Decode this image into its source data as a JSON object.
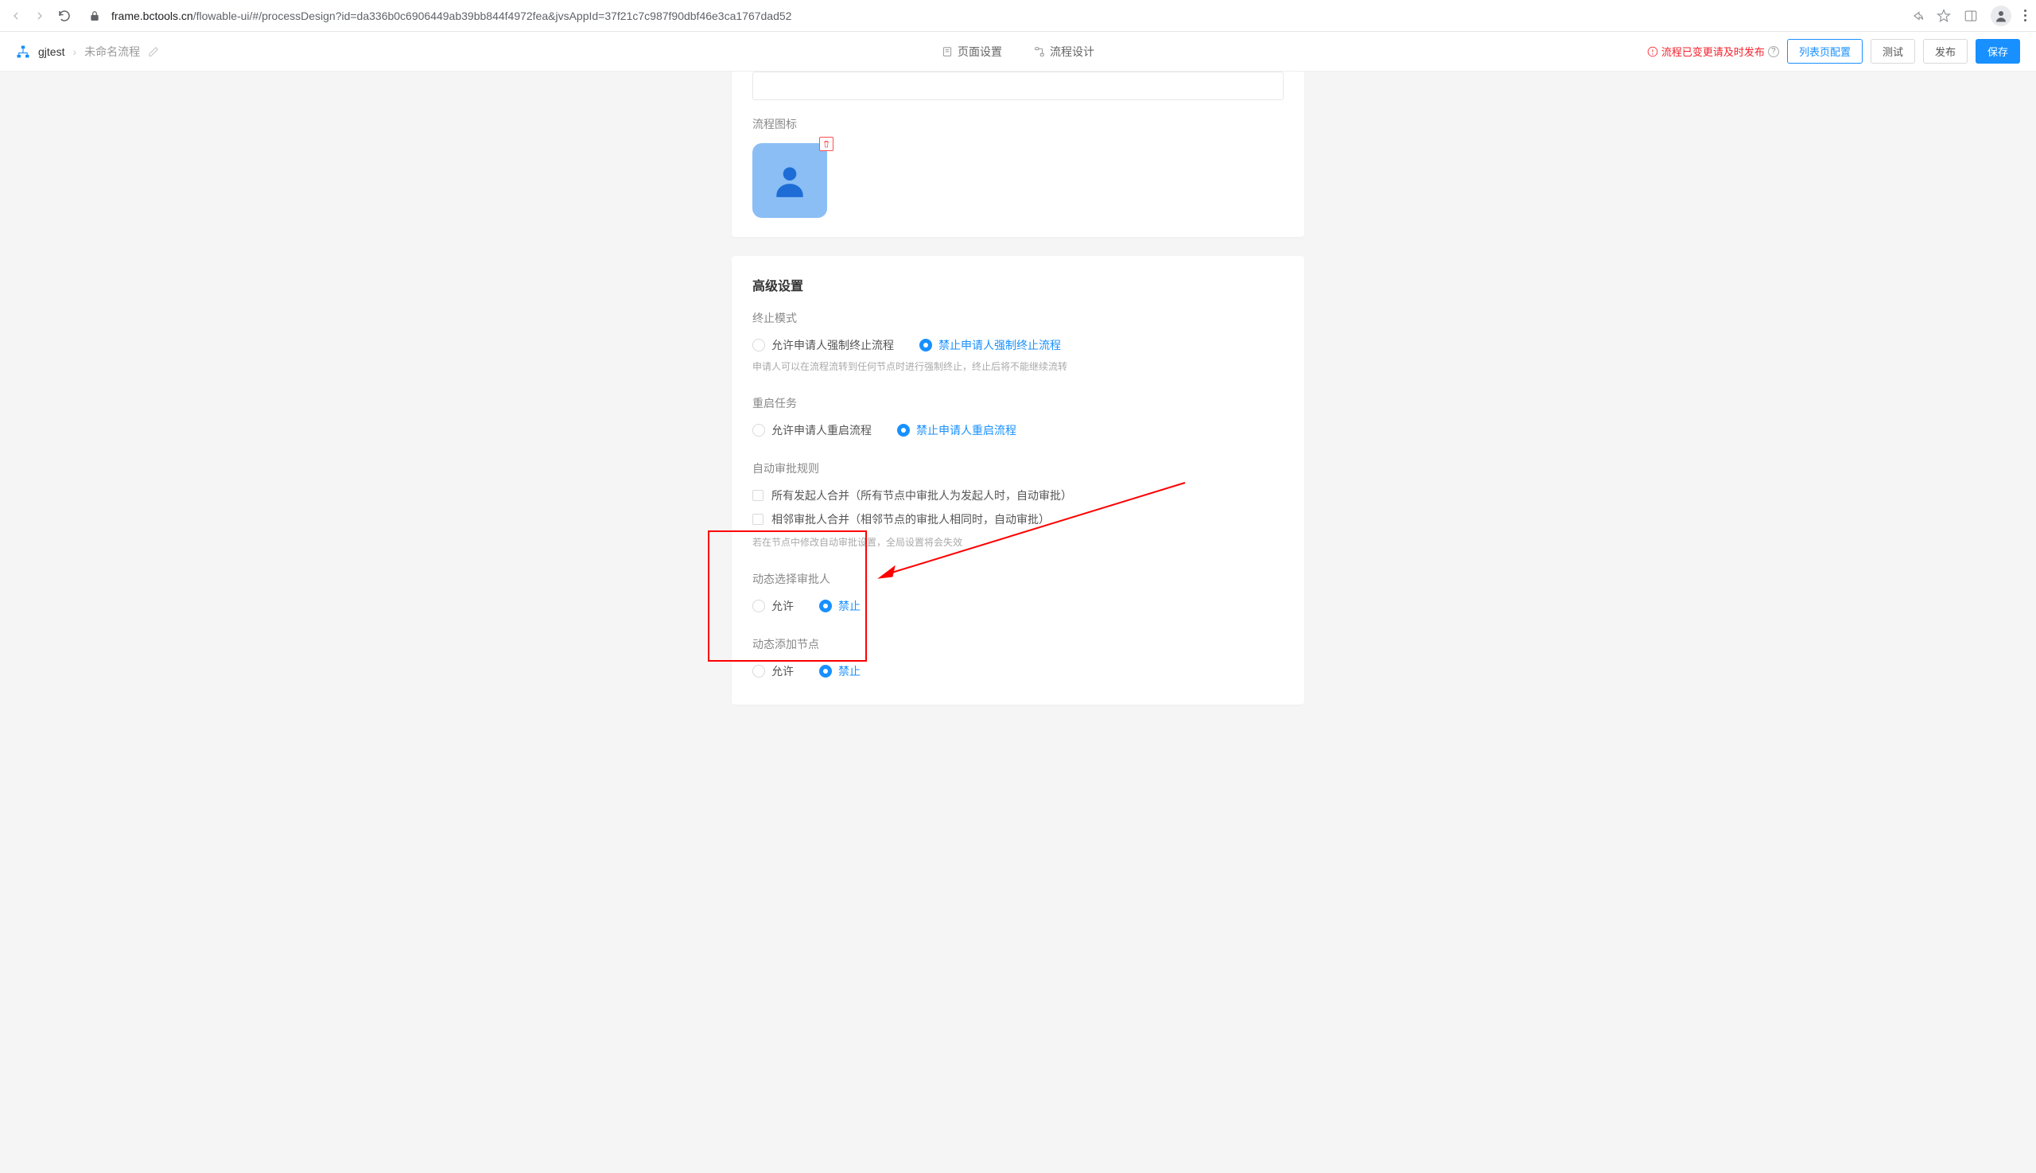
{
  "browser": {
    "url_domain": "frame.bctools.cn",
    "url_path": "/flowable-ui/#/processDesign?id=da336b0c6906449ab39bb844f4972fea&jvsAppId=37f21c7c987f90dbf46e3ca1767dad52"
  },
  "header": {
    "breadcrumb_root": "gjtest",
    "breadcrumb_current": "未命名流程",
    "tab_page": "页面设置",
    "tab_process": "流程设计",
    "status": "流程已变更请及时发布",
    "btn_list_config": "列表页配置",
    "btn_test": "测试",
    "btn_publish": "发布",
    "btn_save": "保存"
  },
  "card1": {
    "icon_label": "流程图标"
  },
  "advanced": {
    "title": "高级设置",
    "terminate": {
      "label": "终止模式",
      "opt_allow": "允许申请人强制终止流程",
      "opt_forbid": "禁止申请人强制终止流程",
      "help": "申请人可以在流程流转到任何节点时进行强制终止，终止后将不能继续流转"
    },
    "restart": {
      "label": "重启任务",
      "opt_allow": "允许申请人重启流程",
      "opt_forbid": "禁止申请人重启流程"
    },
    "auto_approve": {
      "label": "自动审批规则",
      "check1": "所有发起人合并（所有节点中审批人为发起人时，自动审批）",
      "check2": "相邻审批人合并（相邻节点的审批人相同时，自动审批）",
      "help": "若在节点中修改自动审批设置，全局设置将会失效"
    },
    "dynamic_approver": {
      "label": "动态选择审批人",
      "opt_allow": "允许",
      "opt_forbid": "禁止"
    },
    "dynamic_node": {
      "label": "动态添加节点",
      "opt_allow": "允许",
      "opt_forbid": "禁止"
    }
  }
}
